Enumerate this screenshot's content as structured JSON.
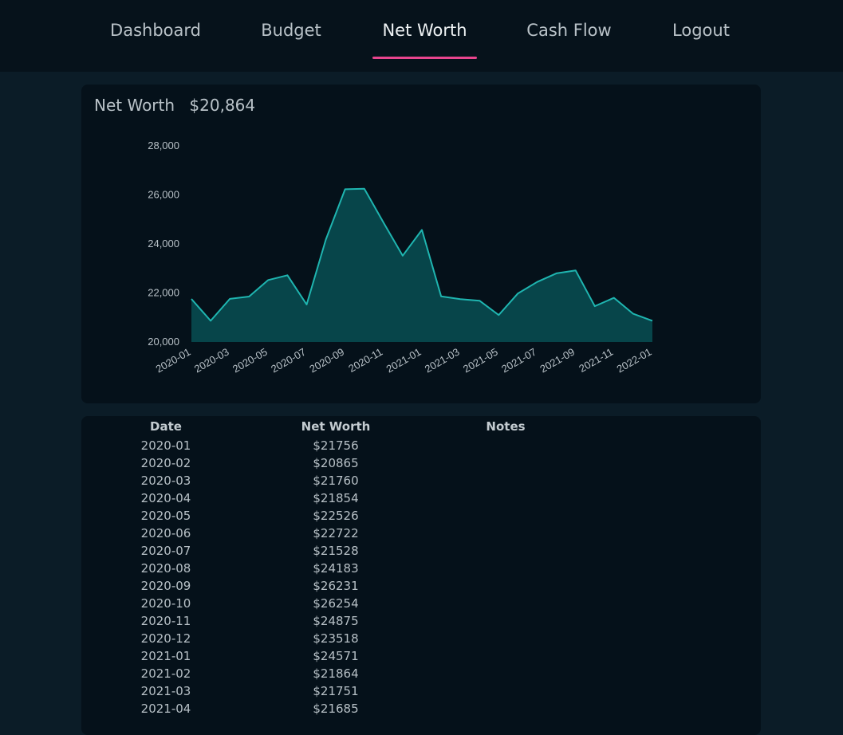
{
  "nav": {
    "items": [
      {
        "label": "Dashboard",
        "active": false
      },
      {
        "label": "Budget",
        "active": false
      },
      {
        "label": "Net Worth",
        "active": true
      },
      {
        "label": "Cash Flow",
        "active": false
      },
      {
        "label": "Logout",
        "active": false
      }
    ]
  },
  "summary": {
    "title": "Net Worth",
    "amount": "$20,864"
  },
  "colors": {
    "accent": "#e8458e",
    "line": "#1fb5b0",
    "area": "#07454a"
  },
  "chart_data": {
    "type": "area",
    "title": "",
    "xlabel": "",
    "ylabel": "",
    "x": [
      "2020-01",
      "2020-02",
      "2020-03",
      "2020-04",
      "2020-05",
      "2020-06",
      "2020-07",
      "2020-08",
      "2020-09",
      "2020-10",
      "2020-11",
      "2020-12",
      "2021-01",
      "2021-02",
      "2021-03",
      "2021-04",
      "2021-05",
      "2021-06",
      "2021-07",
      "2021-08",
      "2021-09",
      "2021-10",
      "2021-11",
      "2021-12",
      "2022-01"
    ],
    "values": [
      21756,
      20865,
      21760,
      21854,
      22526,
      22722,
      21528,
      24183,
      26231,
      26254,
      24875,
      23518,
      24571,
      21864,
      21751,
      21685,
      21100,
      21980,
      22450,
      22800,
      22920,
      21460,
      21800,
      21150,
      20864
    ],
    "ylim": [
      20000,
      28000
    ],
    "yticks": [
      20000,
      22000,
      24000,
      26000,
      28000
    ],
    "ytick_labels": [
      "20,000",
      "22,000",
      "24,000",
      "26,000",
      "28,000"
    ],
    "xticks": [
      "2020-01",
      "2020-03",
      "2020-05",
      "2020-07",
      "2020-09",
      "2020-11",
      "2021-01",
      "2021-03",
      "2021-05",
      "2021-07",
      "2021-09",
      "2021-11",
      "2022-01"
    ],
    "grid": false,
    "legend": "none"
  },
  "table": {
    "headers": {
      "date": "Date",
      "net_worth": "Net Worth",
      "notes": "Notes"
    },
    "rows": [
      {
        "date": "2020-01",
        "net_worth": "$21756",
        "notes": ""
      },
      {
        "date": "2020-02",
        "net_worth": "$20865",
        "notes": ""
      },
      {
        "date": "2020-03",
        "net_worth": "$21760",
        "notes": ""
      },
      {
        "date": "2020-04",
        "net_worth": "$21854",
        "notes": ""
      },
      {
        "date": "2020-05",
        "net_worth": "$22526",
        "notes": ""
      },
      {
        "date": "2020-06",
        "net_worth": "$22722",
        "notes": ""
      },
      {
        "date": "2020-07",
        "net_worth": "$21528",
        "notes": ""
      },
      {
        "date": "2020-08",
        "net_worth": "$24183",
        "notes": ""
      },
      {
        "date": "2020-09",
        "net_worth": "$26231",
        "notes": ""
      },
      {
        "date": "2020-10",
        "net_worth": "$26254",
        "notes": ""
      },
      {
        "date": "2020-11",
        "net_worth": "$24875",
        "notes": ""
      },
      {
        "date": "2020-12",
        "net_worth": "$23518",
        "notes": ""
      },
      {
        "date": "2021-01",
        "net_worth": "$24571",
        "notes": ""
      },
      {
        "date": "2021-02",
        "net_worth": "$21864",
        "notes": ""
      },
      {
        "date": "2021-03",
        "net_worth": "$21751",
        "notes": ""
      },
      {
        "date": "2021-04",
        "net_worth": "$21685",
        "notes": ""
      }
    ]
  }
}
